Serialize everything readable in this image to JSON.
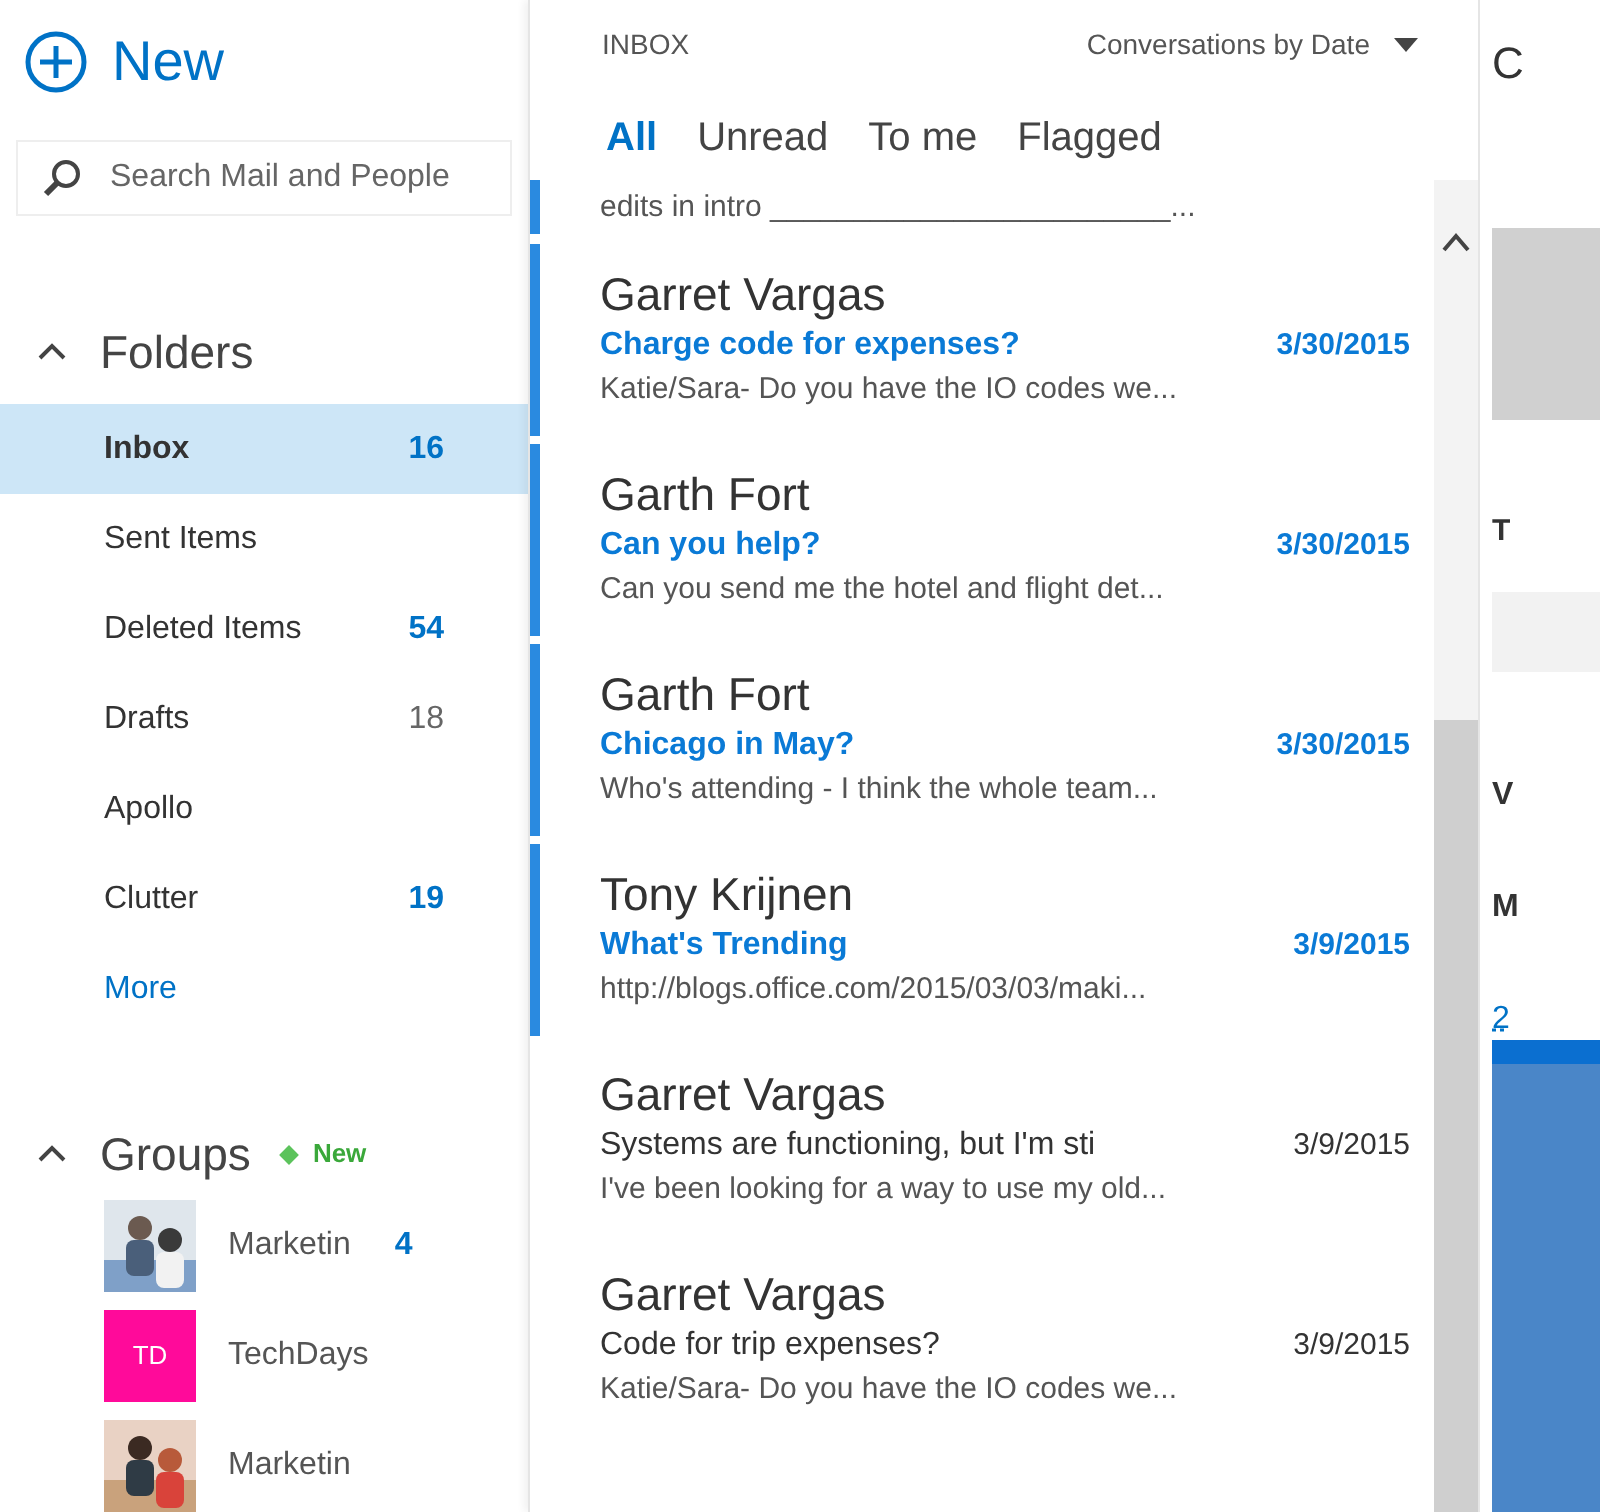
{
  "new_button": {
    "label": "New"
  },
  "search": {
    "placeholder": "Search Mail and People"
  },
  "folders": {
    "heading": "Folders",
    "expanded": true,
    "items": [
      {
        "name": "Inbox",
        "count": "16",
        "unread": true,
        "selected": true
      },
      {
        "name": "Sent Items",
        "selected": false
      },
      {
        "name": "Deleted Items",
        "count": "54",
        "unread": true,
        "selected": false
      },
      {
        "name": "Drafts",
        "count": "18",
        "unread": false,
        "selected": false
      },
      {
        "name": "Apollo",
        "selected": false
      },
      {
        "name": "Clutter",
        "count": "19",
        "unread": true,
        "selected": false
      }
    ],
    "more": "More"
  },
  "groups": {
    "heading": "Groups",
    "expanded": true,
    "badge": "New",
    "items": [
      {
        "name": "Marketin",
        "kind": "picture",
        "count": "4"
      },
      {
        "name": "TechDays",
        "kind": "initials",
        "initials": "TD"
      },
      {
        "name": "Marketin",
        "kind": "picture"
      }
    ]
  },
  "list": {
    "folder": "INBOX",
    "sort": "Conversations by Date",
    "filters": [
      {
        "label": "All",
        "selected": true
      },
      {
        "label": "Unread",
        "selected": false
      },
      {
        "label": "To me",
        "selected": false
      },
      {
        "label": "Flagged",
        "selected": false
      }
    ],
    "partial_preview": {
      "text": "edits in intro ________________________...",
      "unread": true
    },
    "messages": [
      {
        "sender": "Garret Vargas",
        "subject": "Charge code for expenses?",
        "date": "3/30/2015",
        "preview": "Katie/Sara- Do you have the IO codes we...",
        "unread": true
      },
      {
        "sender": "Garth Fort",
        "subject": "Can you help?",
        "date": "3/30/2015",
        "preview": "Can you send me the hotel and flight det...",
        "unread": true
      },
      {
        "sender": "Garth Fort",
        "subject": "Chicago in May?",
        "date": "3/30/2015",
        "preview": "Who's attending - I think the whole team...",
        "unread": true
      },
      {
        "sender": "Tony Krijnen",
        "subject": "What's Trending",
        "date": "3/9/2015",
        "preview": "http://blogs.office.com/2015/03/03/maki...",
        "unread": true
      },
      {
        "sender": "Garret Vargas",
        "subject": "Systems are functioning, but I'm sti",
        "date": "3/9/2015",
        "preview": "I've been looking for a way to use my old...",
        "unread": false
      },
      {
        "sender": "Garret Vargas",
        "subject": "Code for trip expenses?",
        "date": "3/9/2015",
        "preview": "Katie/Sara- Do you have the IO codes we...",
        "unread": false
      }
    ]
  },
  "reading_pane": {
    "title": "C",
    "label_1": "T",
    "label_2": "V",
    "label_3": "M",
    "link": "2"
  }
}
